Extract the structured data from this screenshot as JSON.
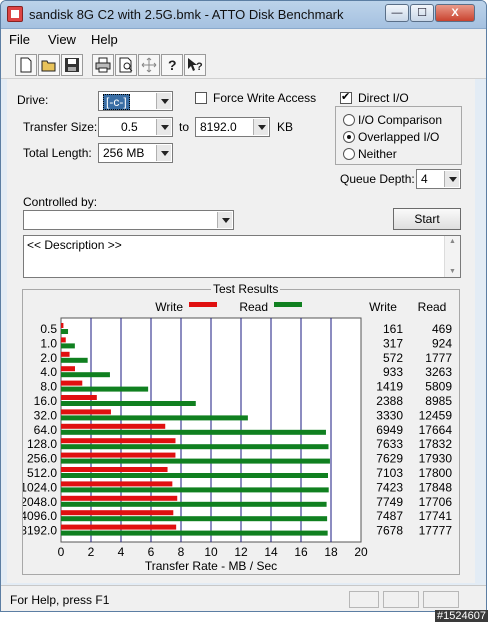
{
  "window": {
    "title": "sandisk 8G C2 with 2.5G.bmk - ATTO Disk Benchmark",
    "buttons": {
      "minimize": "—",
      "maximize": "☐",
      "close": "X"
    }
  },
  "menu": [
    "File",
    "View",
    "Help"
  ],
  "toolbar": {
    "icons": [
      "new-icon",
      "open-icon",
      "save-icon",
      "print-icon",
      "print-preview-icon",
      "move-icon",
      "help-icon",
      "context-help-icon"
    ]
  },
  "form": {
    "drive_label": "Drive:",
    "drive_value": "[-c-]",
    "force_write_label": "Force Write Access",
    "force_write_checked": false,
    "direct_io_label": "Direct I/O",
    "direct_io_checked": true,
    "transfer_size_label": "Transfer Size:",
    "transfer_from": "0.5",
    "to_label": "to",
    "transfer_to": "8192.0",
    "kb_label": "KB",
    "total_length_label": "Total Length:",
    "total_length_value": "256 MB",
    "io_modes": [
      {
        "label": "I/O Comparison",
        "selected": false
      },
      {
        "label": "Overlapped I/O",
        "selected": true
      },
      {
        "label": "Neither",
        "selected": false
      }
    ],
    "queue_depth_label": "Queue Depth:",
    "queue_depth_value": "4",
    "controlled_by_label": "Controlled by:",
    "controlled_by_value": "",
    "start_label": "Start",
    "description": "<< Description >>"
  },
  "results": {
    "title": "Test Results",
    "write_legend": "Write",
    "read_legend": "Read",
    "write_header": "Write",
    "read_header": "Read",
    "write_color": "#e01010",
    "read_color": "#108020"
  },
  "chart_data": {
    "type": "bar",
    "orientation": "horizontal",
    "categories": [
      "0.5",
      "1.0",
      "2.0",
      "4.0",
      "8.0",
      "16.0",
      "32.0",
      "64.0",
      "128.0",
      "256.0",
      "512.0",
      "1024.0",
      "2048.0",
      "4096.0",
      "8192.0"
    ],
    "series": [
      {
        "name": "Write",
        "values": [
          161,
          317,
          572,
          933,
          1419,
          2388,
          3330,
          6949,
          7633,
          7629,
          7103,
          7423,
          7749,
          7487,
          7678
        ]
      },
      {
        "name": "Read",
        "values": [
          469,
          924,
          1777,
          3263,
          5809,
          8985,
          12459,
          17664,
          17832,
          17930,
          17800,
          17848,
          17706,
          17741,
          17777
        ]
      }
    ],
    "x_ticks": [
      "0",
      "2",
      "4",
      "6",
      "8",
      "10",
      "12",
      "14",
      "16",
      "18",
      "20"
    ],
    "xlim": [
      0,
      20
    ],
    "xlabel": "Transfer Rate - MB / Sec",
    "value_unit_divisor": 1000
  },
  "status": {
    "text": "For Help, press F1",
    "watermark": "#1524607"
  }
}
